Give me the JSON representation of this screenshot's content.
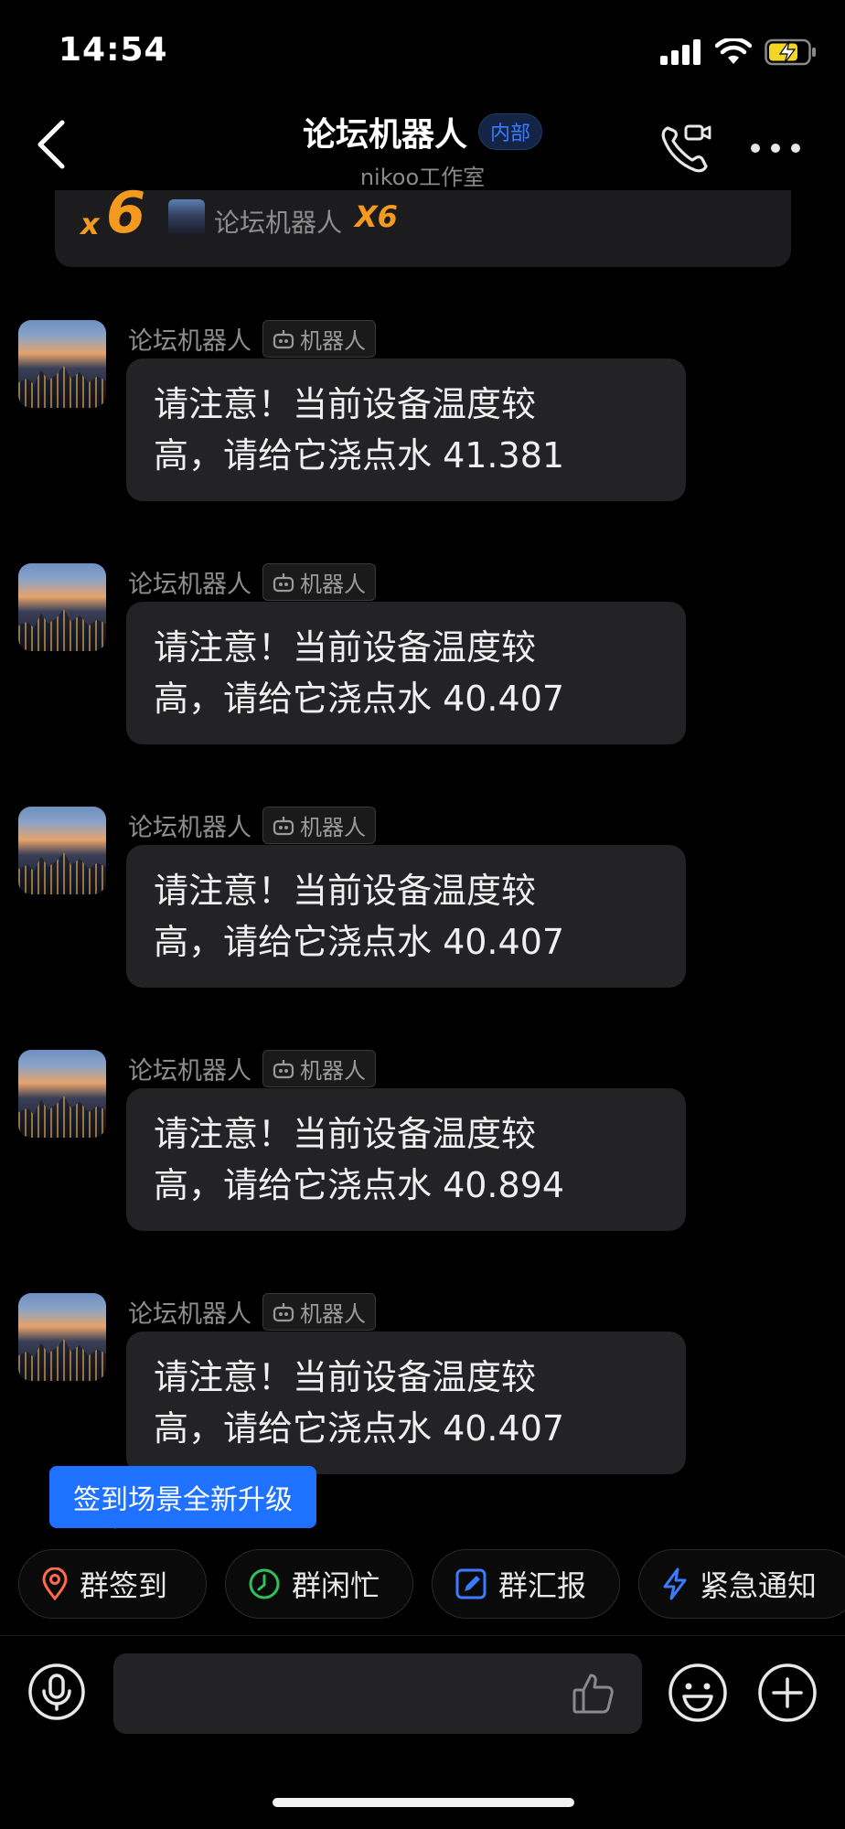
{
  "status_bar": {
    "time": "14:54"
  },
  "nav": {
    "title": "论坛机器人",
    "tag": "内部",
    "subtitle": "nikoo工作室"
  },
  "top_card": {
    "x_small": "x",
    "x_big": "6",
    "sender": "论坛机器人",
    "count": "X6"
  },
  "messages": [
    {
      "sender": "论坛机器人",
      "tag": "机器人",
      "line1": "请注意！当前设备温度较",
      "line2": "高，请给它浇点水 41.381"
    },
    {
      "sender": "论坛机器人",
      "tag": "机器人",
      "line1": "请注意！当前设备温度较",
      "line2": "高，请给它浇点水 40.407"
    },
    {
      "sender": "论坛机器人",
      "tag": "机器人",
      "line1": "请注意！当前设备温度较",
      "line2": "高，请给它浇点水 40.407"
    },
    {
      "sender": "论坛机器人",
      "tag": "机器人",
      "line1": "请注意！当前设备温度较",
      "line2": "高，请给它浇点水 40.894"
    },
    {
      "sender": "论坛机器人",
      "tag": "机器人",
      "line1": "请注意！当前设备温度较",
      "line2": "高，请给它浇点水 40.407"
    }
  ],
  "tooltip": "签到场景全新升级",
  "quick_actions": [
    {
      "label": "群签到",
      "icon": "location-pin-icon",
      "color": "#ff6a4a"
    },
    {
      "label": "群闲忙",
      "icon": "clock-icon",
      "color": "#2fc25b"
    },
    {
      "label": "群汇报",
      "icon": "report-edit-icon",
      "color": "#3a7bff"
    },
    {
      "label": "紧急通知",
      "icon": "lightning-icon",
      "color": "#3a7bff"
    }
  ],
  "colors": {
    "accent": "#1f72ff",
    "orange": "#f39a1f",
    "bubble": "#232325",
    "background": "#000000"
  }
}
